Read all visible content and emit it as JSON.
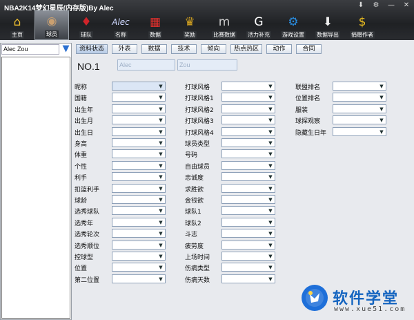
{
  "window": {
    "title": "NBA2K14梦幻星辰(内存版)By Alec",
    "controls": [
      "⬇",
      "⚙",
      "—",
      "✕"
    ]
  },
  "toolbar": [
    {
      "label": "主页",
      "icon": "house-icon",
      "glyph": "⌂",
      "color": "#f0c030"
    },
    {
      "label": "球员",
      "icon": "player-icon",
      "glyph": "◉",
      "color": "#caa070",
      "active": true
    },
    {
      "label": "球队",
      "icon": "team-logo-icon",
      "glyph": "♦",
      "color": "#d0242a"
    },
    {
      "label": "名称",
      "icon": "alec-signature-icon",
      "glyph": "Alec",
      "color": "#cfd8ff"
    },
    {
      "label": "数据",
      "icon": "calendar-icon",
      "glyph": "▦",
      "color": "#e0302c"
    },
    {
      "label": "奖励",
      "icon": "trophy-icon",
      "glyph": "♛",
      "color": "#d8a520"
    },
    {
      "label": "比赛数据",
      "icon": "brand-logo-icon",
      "glyph": "m",
      "color": "#cccccc"
    },
    {
      "label": "活力补充",
      "icon": "gatorade-icon",
      "glyph": "G",
      "color": "#ffffff"
    },
    {
      "label": "游戏设置",
      "icon": "settings-gear-icon",
      "glyph": "⚙",
      "color": "#2a8de0"
    },
    {
      "label": "数据导出",
      "icon": "download-icon",
      "glyph": "⬇",
      "color": "#eeeeee"
    },
    {
      "label": "捐赠作者",
      "icon": "dollar-icon",
      "glyph": "$",
      "color": "#f0c020"
    }
  ],
  "search": {
    "value": "Alec Zou"
  },
  "tabs": [
    "资料状态",
    "外表",
    "数据",
    "技术",
    "倾向",
    "热点热区",
    "动作",
    "合同"
  ],
  "player": {
    "number": "NO.1",
    "first_name": "Alec",
    "last_name": "Zou"
  },
  "columns": [
    [
      "昵称",
      "国籍",
      "出生年",
      "出生月",
      "出生日",
      "身高",
      "体重",
      "个性",
      "利手",
      "扣篮利手",
      "球龄",
      "选秀球队",
      "选秀年",
      "选秀轮次",
      "选秀顺位",
      "控球型",
      "位置",
      "第二位置"
    ],
    [
      "打球风格",
      "打球风格1",
      "打球风格2",
      "打球风格3",
      "打球风格4",
      "球员类型",
      "号码",
      "自由球员",
      "忠诚度",
      "求胜欲",
      "金钱欲",
      "球队1",
      "球队2",
      "斗志",
      "疲劳度",
      "上场时间",
      "伤病类型",
      "伤病天数"
    ],
    [
      "联盟排名",
      "位置排名",
      "服装",
      "球探观察",
      "隐藏生日年"
    ]
  ],
  "watermark": {
    "title": "软件学堂",
    "url": "www.xue51.com"
  }
}
